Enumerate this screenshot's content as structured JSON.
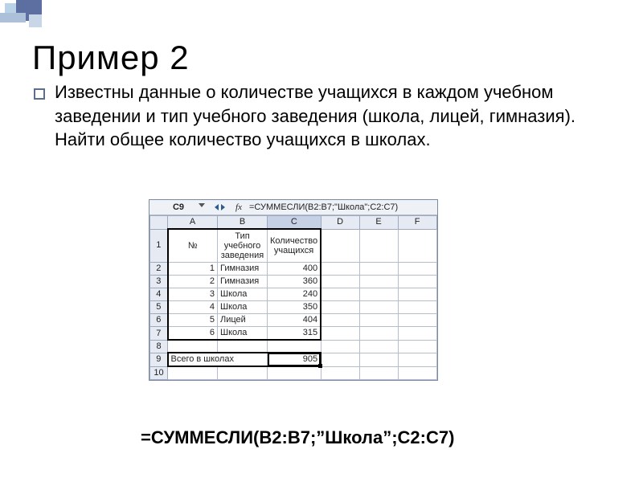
{
  "title": "Пример 2",
  "body_text": "Известны данные о количестве учащихся в каждом учебном заведении и тип учебного заведения (школа, лицей, гимназия). Найти общее количество учащихся в школах.",
  "formula_line": "=СУММЕСЛИ(B2:B7;”Школа”;C2:C7)",
  "sheet": {
    "name_box": "C9",
    "fx_label": "fx",
    "formula": "=СУММЕСЛИ(B2:B7;\"Школа\";C2:C7)",
    "columns": [
      "A",
      "B",
      "C",
      "D",
      "E",
      "F"
    ],
    "row_nums": [
      "1",
      "2",
      "3",
      "4",
      "5",
      "6",
      "7",
      "8",
      "9",
      "10"
    ],
    "headers": {
      "A": "№",
      "B": "Тип учебного заведения",
      "C": "Количество учащихся"
    },
    "rows": [
      {
        "n": "1",
        "type": "Гимназия",
        "count": "400"
      },
      {
        "n": "2",
        "type": "Гимназия",
        "count": "360"
      },
      {
        "n": "3",
        "type": "Школа",
        "count": "240"
      },
      {
        "n": "4",
        "type": "Школа",
        "count": "350"
      },
      {
        "n": "5",
        "type": "Лицей",
        "count": "404"
      },
      {
        "n": "6",
        "type": "Школа",
        "count": "315"
      }
    ],
    "total_label": "Всего в школах",
    "total_value": "905"
  }
}
